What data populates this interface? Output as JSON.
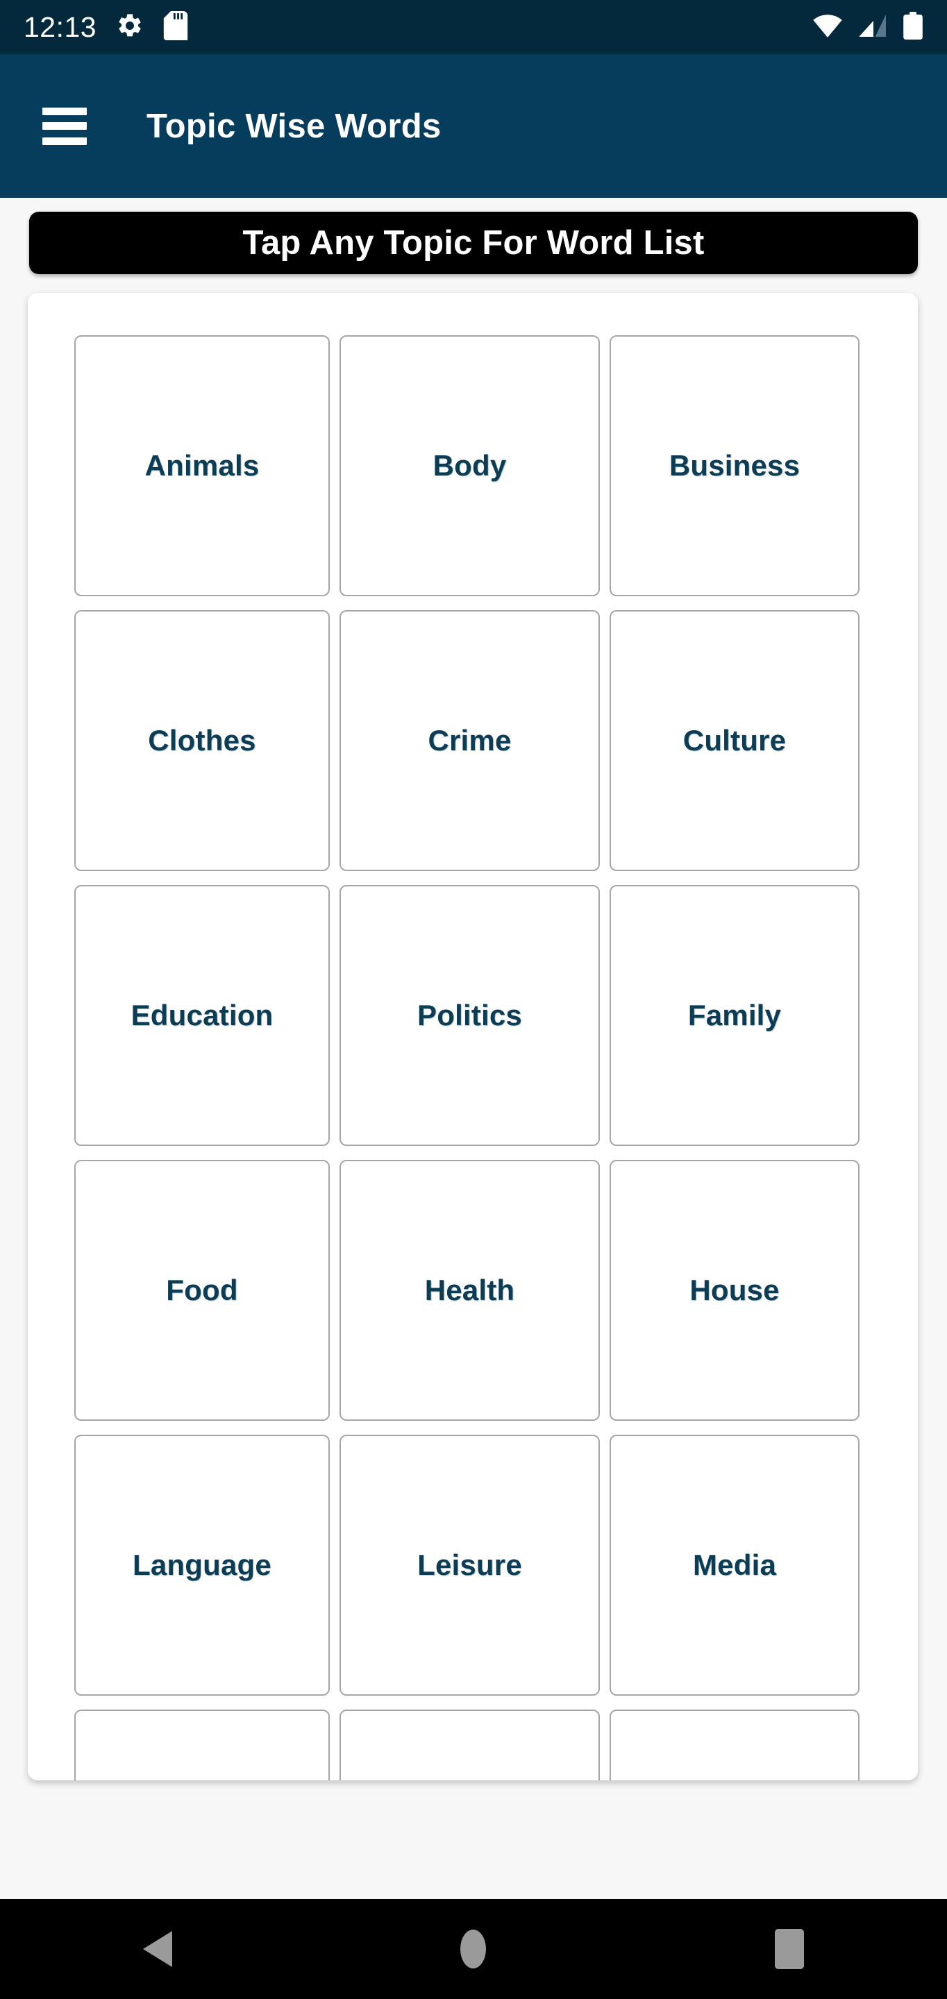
{
  "status_bar": {
    "clock": "12:13",
    "left_icons": [
      {
        "name": "settings-gear-icon"
      },
      {
        "name": "sd-card-icon"
      }
    ],
    "right_icons": [
      {
        "name": "wifi-icon"
      },
      {
        "name": "cellular-signal-icon"
      },
      {
        "name": "battery-icon"
      }
    ],
    "background_color": "#04283c"
  },
  "app_bar": {
    "menu_icon": "hamburger-menu-icon",
    "title": "Topic Wise Words",
    "background_color": "#063d5c"
  },
  "banner": {
    "text": "Tap Any Topic For Word List",
    "background_color": "#000000",
    "text_color": "#ffffff"
  },
  "topics": {
    "label_color": "#0d3c55",
    "border_color": "#a6a6a6",
    "items": [
      {
        "label": "Animals"
      },
      {
        "label": "Body"
      },
      {
        "label": "Business"
      },
      {
        "label": "Clothes"
      },
      {
        "label": "Crime"
      },
      {
        "label": "Culture"
      },
      {
        "label": "Education"
      },
      {
        "label": "Politics"
      },
      {
        "label": "Family"
      },
      {
        "label": "Food"
      },
      {
        "label": "Health"
      },
      {
        "label": "House"
      },
      {
        "label": "Language"
      },
      {
        "label": "Leisure"
      },
      {
        "label": "Media"
      },
      {
        "label": ""
      },
      {
        "label": ""
      },
      {
        "label": ""
      }
    ]
  },
  "nav_bar": {
    "background_color": "#000000",
    "icon_color": "#9a9a9a",
    "buttons": [
      {
        "name": "back-button"
      },
      {
        "name": "home-button"
      },
      {
        "name": "recents-button"
      }
    ]
  }
}
